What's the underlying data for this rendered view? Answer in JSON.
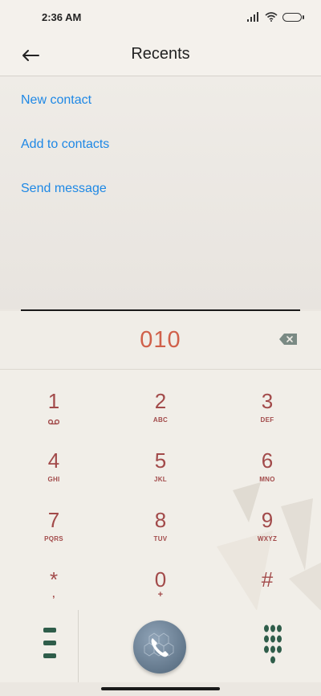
{
  "status_bar": {
    "time": "2:36 AM"
  },
  "header": {
    "title": "Recents"
  },
  "menu": {
    "items": [
      {
        "label": "New contact"
      },
      {
        "label": "Add to contacts"
      },
      {
        "label": "Send message"
      }
    ]
  },
  "dialer": {
    "entered_number": "010"
  },
  "keypad": {
    "keys": [
      {
        "digit": "1",
        "sub": ""
      },
      {
        "digit": "2",
        "sub": "ABC"
      },
      {
        "digit": "3",
        "sub": "DEF"
      },
      {
        "digit": "4",
        "sub": "GHI"
      },
      {
        "digit": "5",
        "sub": "JKL"
      },
      {
        "digit": "6",
        "sub": "MNO"
      },
      {
        "digit": "7",
        "sub": "PQRS"
      },
      {
        "digit": "8",
        "sub": "TUV"
      },
      {
        "digit": "9",
        "sub": "WXYZ"
      },
      {
        "digit": "*",
        "sub": ","
      },
      {
        "digit": "0",
        "sub": "+"
      },
      {
        "digit": "#",
        "sub": ""
      }
    ]
  },
  "colors": {
    "accent_link": "#1e88e5",
    "digit_color": "#a24a4a",
    "entered_number_color": "#d0604a",
    "icon_green": "#2f5d4a"
  }
}
